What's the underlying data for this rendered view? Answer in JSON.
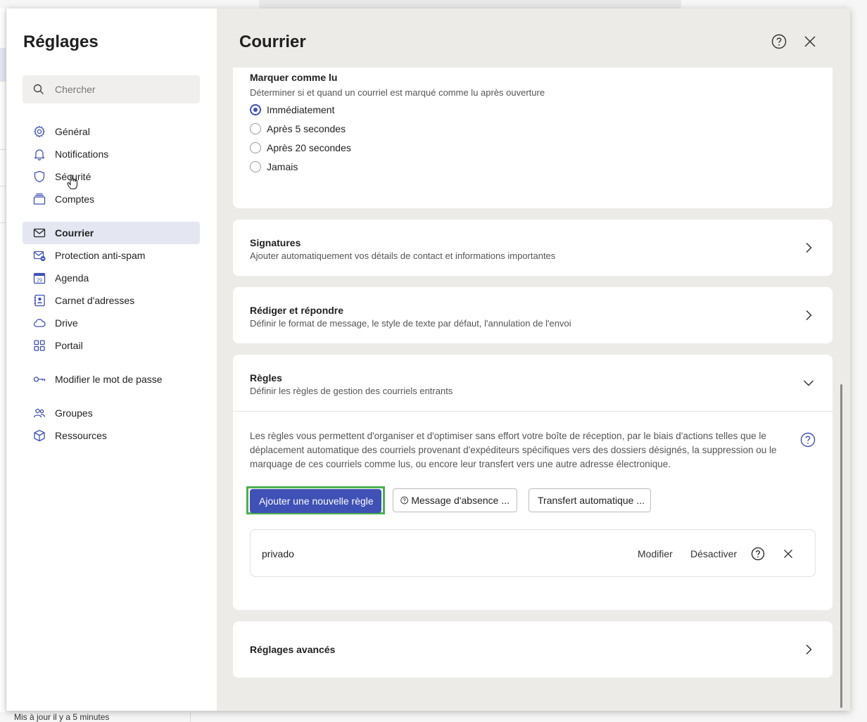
{
  "background": {
    "status_text": "Mis à jour il y a 5 minutes"
  },
  "sidebar": {
    "title": "Réglages",
    "search_placeholder": "Chercher",
    "items": [
      {
        "label": "Général",
        "icon": "gear-icon"
      },
      {
        "label": "Notifications",
        "icon": "bell-icon"
      },
      {
        "label": "Sécurité",
        "icon": "shield-icon"
      },
      {
        "label": "Comptes",
        "icon": "stack-icon"
      },
      {
        "label": "Courrier",
        "icon": "mail-icon",
        "active": true
      },
      {
        "label": "Protection anti-spam",
        "icon": "mail-block-icon"
      },
      {
        "label": "Agenda",
        "icon": "calendar-icon",
        "calendar_day": "29"
      },
      {
        "label": "Carnet d'adresses",
        "icon": "contact-book-icon"
      },
      {
        "label": "Drive",
        "icon": "cloud-icon"
      },
      {
        "label": "Portail",
        "icon": "grid-icon"
      },
      {
        "label": "Modifier le mot de passe",
        "icon": "key-icon"
      },
      {
        "label": "Groupes",
        "icon": "people-icon"
      },
      {
        "label": "Ressources",
        "icon": "cube-icon"
      }
    ]
  },
  "main": {
    "title": "Courrier",
    "mark_read": {
      "title": "Marquer comme lu",
      "subtitle": "Déterminer si et quand un courriel est marqué comme lu après ouverture",
      "options": [
        "Immédiatement",
        "Après 5 secondes",
        "Après 20 secondes",
        "Jamais"
      ],
      "selected": "Immédiatement"
    },
    "signatures": {
      "title": "Signatures",
      "subtitle": "Ajouter automatiquement vos détails de contact et informations importantes"
    },
    "compose": {
      "title": "Rédiger et répondre",
      "subtitle": "Définir le format de message, le style de texte par défaut, l'annulation de l'envoi"
    },
    "rules": {
      "title": "Règles",
      "subtitle": "Définir les règles de gestion des courriels entrants",
      "description": "Les règles vous permettent d'organiser et d'optimiser sans effort votre boîte de réception, par le biais d'actions telles que le déplacement automatique des courriels provenant d'expéditeurs spécifiques vers des dossiers désignés, la suppression ou le marquage de ces courriels comme lus, ou encore leur transfert vers une autre adresse électronique.",
      "add_button": "Ajouter une nouvelle règle",
      "absence_button": "Message d'absence ...",
      "forward_button": "Transfert automatique ...",
      "items": [
        {
          "name": "privado",
          "edit": "Modifier",
          "disable": "Désactiver"
        }
      ]
    },
    "advanced": {
      "title": "Réglages avancés"
    }
  },
  "colors": {
    "accent": "#3f51b5",
    "highlight": "#4caf50",
    "active_nav": "#e4e7f2",
    "panel_bg": "#edebe7"
  }
}
